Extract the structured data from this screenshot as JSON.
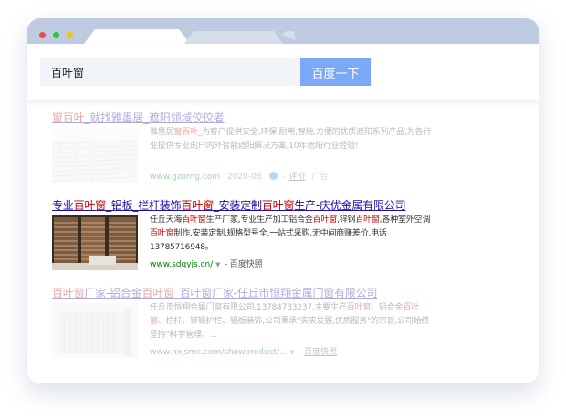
{
  "colors": {
    "accent": "#7aa9f7",
    "link": "#1a0dab",
    "highlight": "#cc0000",
    "url": "#008000"
  },
  "search": {
    "query": "百叶窗",
    "button_label": "百度一下"
  },
  "results": [
    {
      "title": [
        "窗百叶",
        "_就找雅墨居_遮阳领域佼佼者"
      ],
      "desc": [
        "雅墨居",
        "窗百叶",
        "_为客户提供安全,环保,耐用,智能,方便的优质遮阳系列产品,为各行业提供专业的户内外智能遮阳解决方案,10年遮阳行业经验!"
      ],
      "url": "www.gzorng.com",
      "date": "2020-08",
      "rating": "评价",
      "ad": "广告"
    },
    {
      "title": [
        "专业",
        "百叶窗",
        "_铝板_栏杆装饰",
        "百叶窗",
        "_安装定制",
        "百叶窗",
        "生产-庆优金属有限公司"
      ],
      "desc": [
        "任丘天海",
        "百叶窗",
        "生产厂家,专业生产加工铝合金",
        "百叶窗",
        ",锌钢",
        "百叶窗",
        ",各种室外空调",
        "百叶窗",
        "制作,安装定制,规格型号全,一站式采购,无中间商赚差价,电话13785716948。"
      ],
      "url": "www.sdqyjs.cn/",
      "snapshot": "百度快照"
    },
    {
      "title": [
        "百叶窗",
        "厂家-铝合金",
        "百叶窗",
        "_百叶窗",
        "厂家-任丘市恒翔金属门窗有限公司"
      ],
      "desc": [
        "任丘市恒翔金属门窗有限公司,13784733237,主要生产",
        "百叶窗",
        "、铝合金",
        "百叶窗",
        "、栏杆、锌钢护栏、铝板装饰,公司秉承\"实实发展,优质服务\"的宗旨,公司始终坚持\"科学管理、..."
      ],
      "url": "www.hxjsmc.com/showproduct/...",
      "snapshot": "百度快照"
    }
  ]
}
